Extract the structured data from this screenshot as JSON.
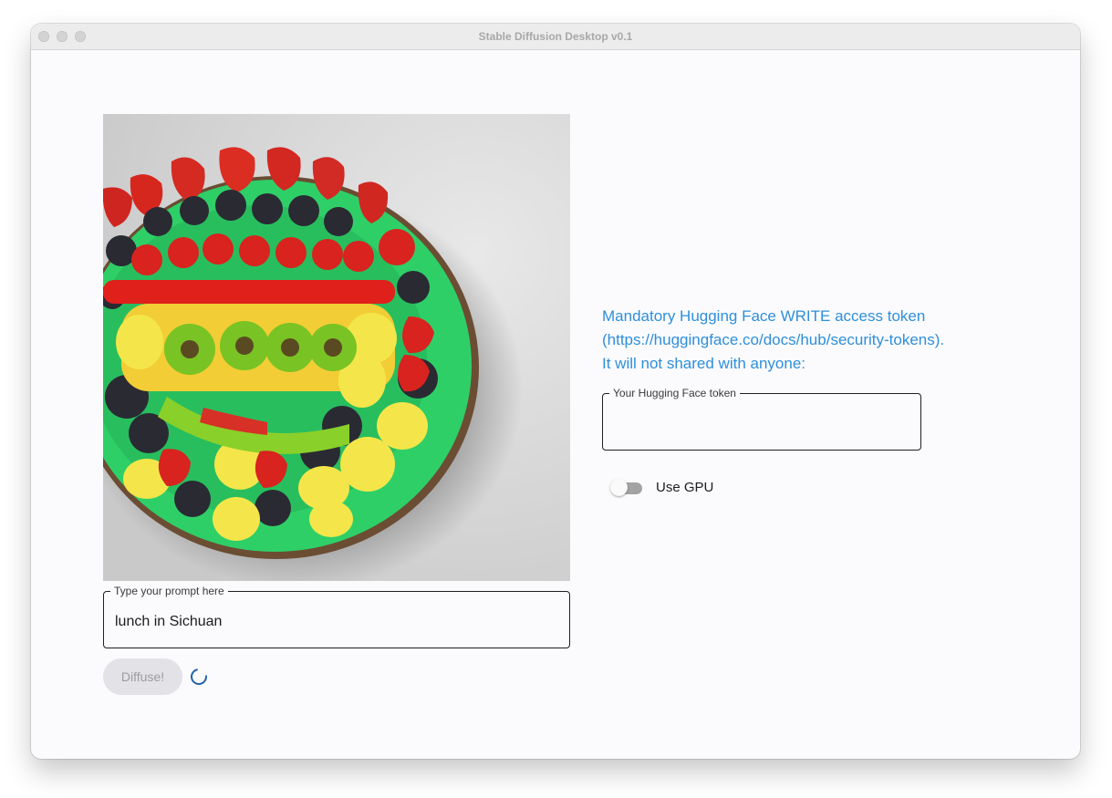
{
  "window": {
    "title": "Stable Diffusion Desktop v0.1"
  },
  "prompt": {
    "label": "Type your prompt here",
    "value": "lunch in Sichuan"
  },
  "actions": {
    "diffuse_label": "Diffuse!",
    "diffuse_enabled": false,
    "loading": true
  },
  "token": {
    "notice": "Mandatory Hugging Face WRITE access token\n(https://huggingface.co/docs/hub/security-tokens).\nIt will not shared with anyone:",
    "label": "Your Hugging Face token",
    "value": ""
  },
  "gpu": {
    "label": "Use GPU",
    "enabled": false
  },
  "colors": {
    "accent": "#2f8fd8",
    "spinner": "#1f63a8",
    "disabled_button_bg": "#e3e2e6",
    "window_bg": "#fbfbfe"
  },
  "icons": {
    "generated_image": "generated-image (fruit platter)",
    "progress": "progress-spinner-icon"
  }
}
